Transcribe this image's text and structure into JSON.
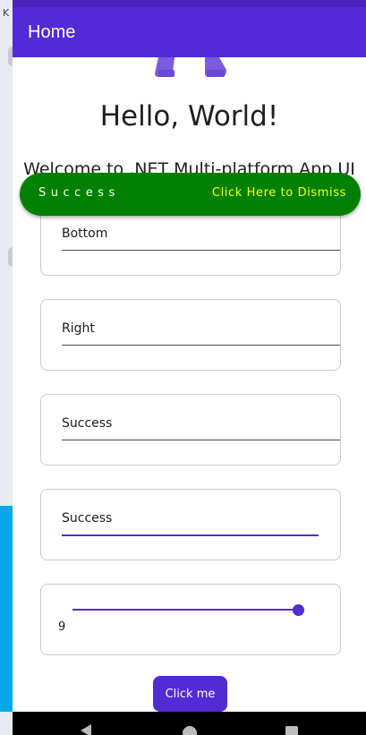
{
  "background_window": {
    "letter": "K"
  },
  "app_bar": {
    "title": "Home"
  },
  "main": {
    "heading": "Hello, World!",
    "subheading": "Welcome to .NET Multi-platform App UI"
  },
  "entries": [
    {
      "value": "Bottom"
    },
    {
      "value": "Right"
    },
    {
      "value": "Success"
    },
    {
      "value": "Success",
      "focused": true
    }
  ],
  "slider": {
    "value_label": "9",
    "fill_fraction": 1.0
  },
  "button": {
    "label": "Click me"
  },
  "toast": {
    "message": "Success",
    "dismiss_label": "Click Here to Dismiss",
    "background_color": "#008000",
    "dismiss_color": "#ffff00"
  },
  "colors": {
    "primary": "#512bd4",
    "app_bar": "#512bd4"
  }
}
